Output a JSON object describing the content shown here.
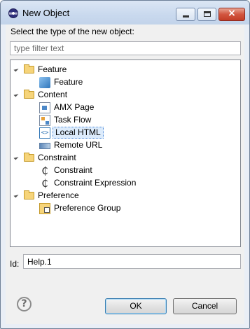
{
  "window": {
    "title": "New Object",
    "controls": {
      "minimize": "minimize-icon",
      "maximize": "maximize-icon",
      "close": "close-icon"
    }
  },
  "prompt": "Select the type of the new object:",
  "filter": {
    "placeholder": "type filter text",
    "value": ""
  },
  "tree": [
    {
      "label": "Feature",
      "expanded": true,
      "children": [
        {
          "label": "Feature",
          "icon": "feature-cube-icon",
          "selected": false
        }
      ]
    },
    {
      "label": "Content",
      "expanded": true,
      "children": [
        {
          "label": "AMX Page",
          "icon": "amx-page-icon",
          "selected": false
        },
        {
          "label": "Task Flow",
          "icon": "task-flow-icon",
          "selected": false
        },
        {
          "label": "Local HTML",
          "icon": "html-file-icon",
          "selected": true
        },
        {
          "label": "Remote URL",
          "icon": "url-icon",
          "selected": false
        }
      ]
    },
    {
      "label": "Constraint",
      "expanded": true,
      "children": [
        {
          "label": "Constraint",
          "icon": "constraint-icon",
          "selected": false
        },
        {
          "label": "Constraint Expression",
          "icon": "constraint-expression-icon",
          "selected": false
        }
      ]
    },
    {
      "label": "Preference",
      "expanded": true,
      "children": [
        {
          "label": "Preference Group",
          "icon": "preference-group-icon",
          "selected": false
        }
      ]
    }
  ],
  "id_field": {
    "label": "Id:",
    "value": "Help.1"
  },
  "buttons": {
    "help": "?",
    "ok": "OK",
    "cancel": "Cancel"
  },
  "colors": {
    "titlebar": "#c9d9ee",
    "selection": "#dcebfb",
    "close": "#c33d26"
  }
}
